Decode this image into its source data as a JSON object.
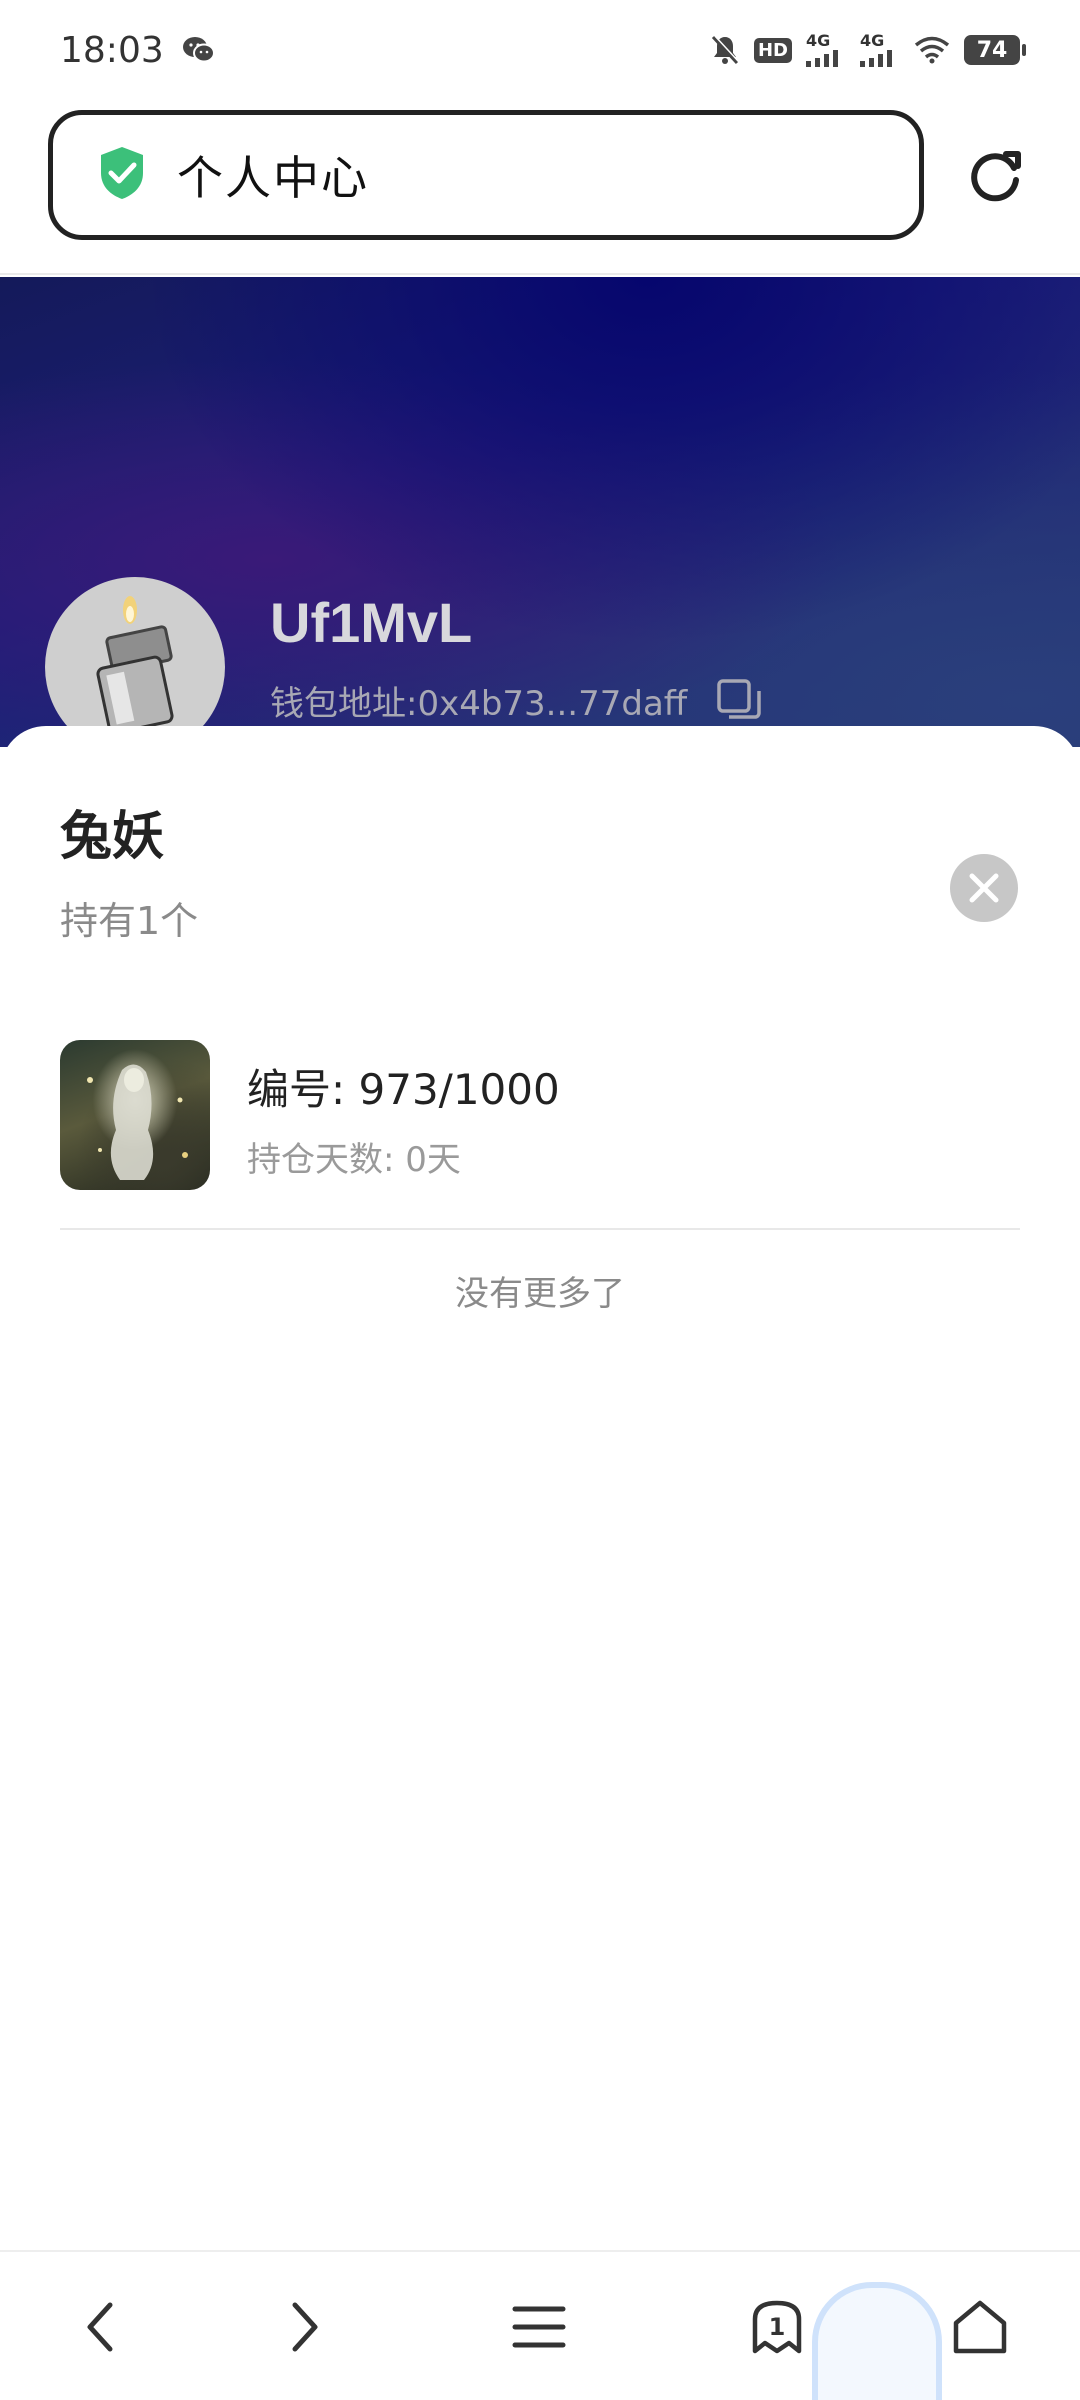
{
  "status_bar": {
    "time": "18:03",
    "app_icons": [
      "wechat-icon"
    ],
    "indicators": [
      "mute-icon",
      "hd-icon",
      "4g-signal-icon",
      "4g-signal-icon",
      "wifi-icon"
    ],
    "signal_label_1": "4G",
    "signal_label_2": "4G",
    "hd_label": "HD",
    "battery": "74"
  },
  "address_bar": {
    "title": "个人中心",
    "secure_icon": "shield-check-icon",
    "refresh_icon": "refresh-icon"
  },
  "profile": {
    "username": "Uf1MvL",
    "wallet_address": "钱包地址:0x4b73...77daff",
    "copy_icon": "copy-icon",
    "avatar_icon": "lighter-avatar"
  },
  "sheet": {
    "title": "兔妖",
    "subtitle": "持有1个",
    "close_icon": "close-icon",
    "items": [
      {
        "number": "编号: 973/1000",
        "holding_days": "持仓天数: 0天"
      }
    ],
    "footer": "没有更多了"
  },
  "bottom_nav": {
    "items": [
      {
        "name": "back",
        "icon": "chevron-left-icon"
      },
      {
        "name": "forward",
        "icon": "chevron-right-icon"
      },
      {
        "name": "menu",
        "icon": "menu-icon"
      },
      {
        "name": "tabs",
        "icon": "tabs-icon",
        "count": "1"
      },
      {
        "name": "home",
        "icon": "home-icon"
      }
    ]
  },
  "colors": {
    "secure_green": "#3cc07a",
    "hero_dark_blue": "#1c1e78",
    "divider": "#e8e8e8",
    "close_bg": "#c7c7c7"
  }
}
